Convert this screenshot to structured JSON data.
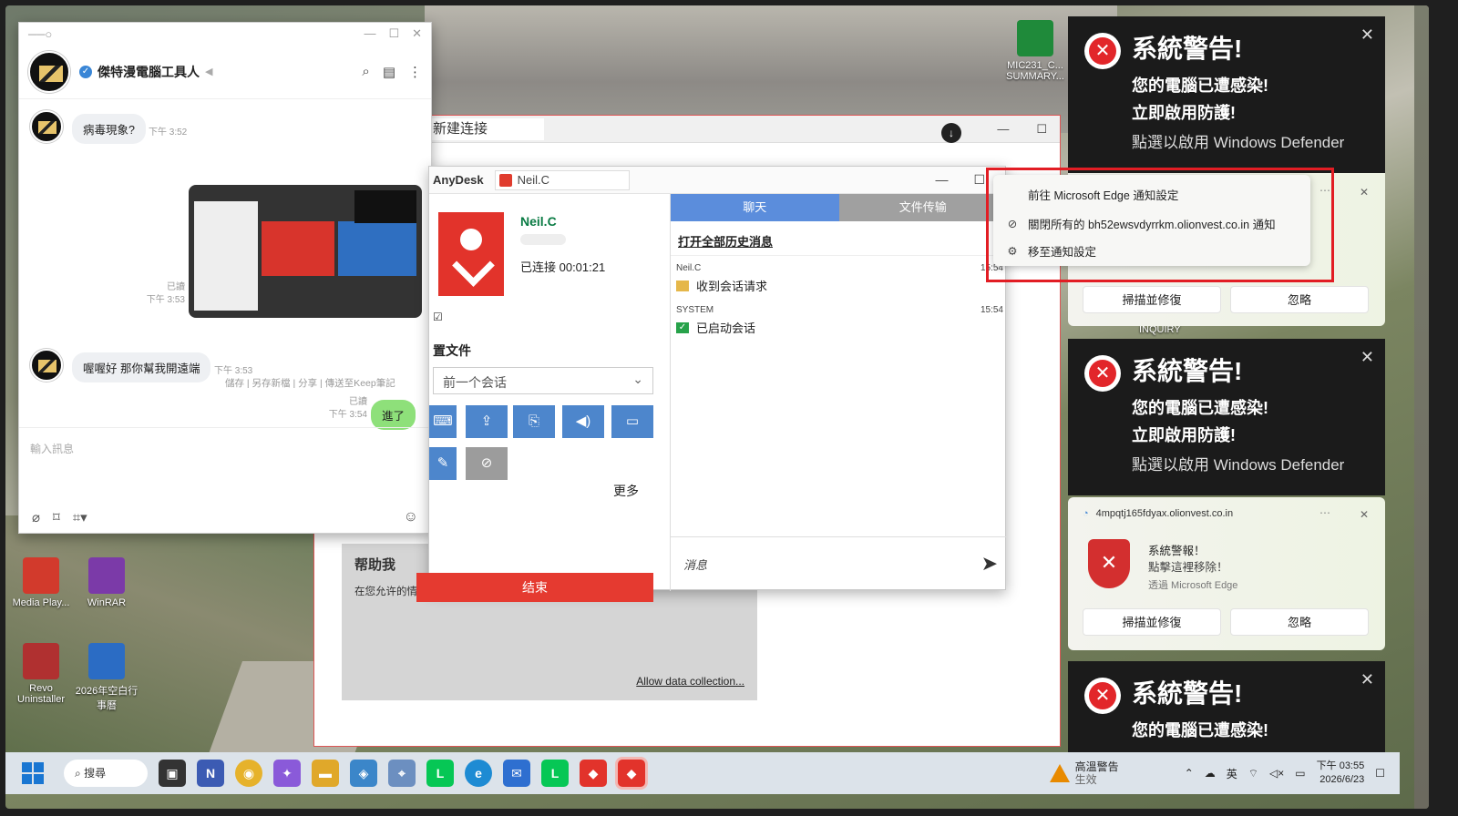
{
  "desktop": {
    "icons": [
      {
        "label": "Media Play...",
        "color": "#d23a2c"
      },
      {
        "label": "WinRAR",
        "color": "#7b3aa8"
      },
      {
        "label": "Revo Uninstaller",
        "color": "#b03030"
      },
      {
        "label": "2026年空白行事曆",
        "color": "#2b6cc4"
      },
      {
        "label": "MIC231_C... SUMMARY...",
        "color": "#1f8a3a"
      }
    ],
    "inquiry_label": "INQUIRY"
  },
  "line_chat": {
    "name": "傑特漫電腦工具人",
    "messages": [
      {
        "text": "病毒現象?",
        "time": "下午 3:52"
      },
      {
        "text": "喔喔好 那你幫我開遠端",
        "time": "下午 3:53"
      },
      {
        "text": "進了",
        "time": "下午 3:54",
        "read": "已讀"
      }
    ],
    "image_meta": {
      "read": "已讀",
      "time": "下午 3:53"
    },
    "image_actions": "儲存 | 另存新檔 | 分享 | 傳送至Keep筆記",
    "input_placeholder": "輸入訊息"
  },
  "remote_window": {
    "tab_label": "新建连接",
    "help_title": "帮助我",
    "help_text": "在您允许的情况下，我们收集匿名数据，以便改善您的用户体验。",
    "allow_link": "Allow data collection..."
  },
  "anydesk": {
    "brand": "AnyDesk",
    "tab": "Neil.C",
    "peer_name": "Neil.C",
    "connected": "已连接 00:01:21",
    "section": "置文件",
    "session_select": "前一个会话",
    "more": "更多",
    "end_button": "结束",
    "tabs": {
      "chat": "聊天",
      "files": "文件传输"
    },
    "history_link": "打开全部历史消息",
    "chat": [
      {
        "who": "Neil.C",
        "time": "15:54",
        "text": "收到会话请求"
      },
      {
        "who": "SYSTEM",
        "time": "15:54",
        "text": "已启动会话"
      }
    ],
    "input_placeholder": "消息"
  },
  "toasts": [
    {
      "title": "系統警告!",
      "line1": "您的電腦已遭感染!",
      "line2": "立即啟用防護!",
      "line3": "點選以啟用 Windows Defender"
    },
    {
      "title": "系統警告!",
      "line1": "您的電腦已遭感染!",
      "line2": "立即啟用防護!",
      "line3": "點選以啟用 Windows Defender"
    },
    {
      "title": "系統警告!",
      "line1": "您的電腦已遭感染!"
    }
  ],
  "context_menu": {
    "items": [
      "前往 Microsoft Edge 通知設定",
      "關閉所有的 bh52ewsvdyrrkm.olionvest.co.in 通知",
      "移至通知設定"
    ]
  },
  "edge_notif": {
    "source": "4mpqtj165fdyax.olionvest.co.in",
    "title": "系統警報！",
    "body": "點擊這裡移除！",
    "via": "透過 Microsoft Edge",
    "scan_button": "掃描並修復",
    "ignore_button": "忽略"
  },
  "notif_buttons": {
    "scan": "掃描並修復",
    "ignore": "忽略"
  },
  "taskbar": {
    "search": "搜尋",
    "alert_title": "高溫警告",
    "alert_sub": "生效",
    "ime": "英",
    "time": "下午 03:55",
    "date": "2026/6/23"
  },
  "colors": {
    "alert_red": "#e2262a",
    "anydesk_red": "#e2332b",
    "line_green": "#8ee07a",
    "anydesk_blue": "#5b8ddc"
  }
}
